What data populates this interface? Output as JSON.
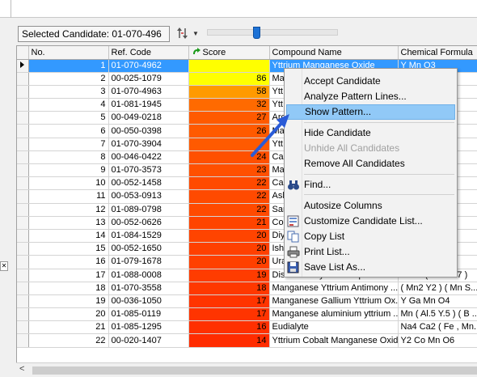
{
  "toolbar": {
    "selected_candidate": "Selected Candidate: 01-070-496"
  },
  "grid": {
    "columns": [
      "No.",
      "Ref. Code",
      "Score",
      "Compound Name",
      "Chemical Formula"
    ],
    "rows": [
      {
        "no": "1",
        "ref": "01-070-4962",
        "score": "",
        "name": "Yttrium Manganese Oxide",
        "formula": "Y Mn O3",
        "color": "#ffff00"
      },
      {
        "no": "2",
        "ref": "00-025-1079",
        "score": "86",
        "name": "Ma",
        "formula": "",
        "color": "#ffff00"
      },
      {
        "no": "3",
        "ref": "01-070-4963",
        "score": "58",
        "name": "Ytt",
        "formula": "",
        "color": "#ff9a00"
      },
      {
        "no": "4",
        "ref": "01-081-1945",
        "score": "32",
        "name": "Ytt",
        "formula": "",
        "color": "#ff6a00"
      },
      {
        "no": "5",
        "ref": "00-049-0218",
        "score": "27",
        "name": "Arc",
        "formula": "O7",
        "color": "#ff5a00"
      },
      {
        "no": "6",
        "ref": "00-050-0398",
        "score": "26",
        "name": "Ma",
        "formula": "",
        "color": "#ff5a00"
      },
      {
        "no": "7",
        "ref": "01-070-3904",
        "score": "",
        "name": "Ytt",
        "formula": "O6 ..",
        "color": "#ff5a00"
      },
      {
        "no": "8",
        "ref": "00-046-0422",
        "score": "24",
        "name": "Cal",
        "formula": "",
        "color": "#ff5000"
      },
      {
        "no": "9",
        "ref": "01-070-3573",
        "score": "23",
        "name": "Ma",
        "formula": "3 ) (",
        "color": "#ff5000"
      },
      {
        "no": "10",
        "ref": "00-052-1458",
        "score": "22",
        "name": "Cal",
        "formula": "7",
        "color": "#ff4a00"
      },
      {
        "no": "11",
        "ref": "00-053-0913",
        "score": "22",
        "name": "Ash",
        "formula": "",
        "color": "#ff4a00"
      },
      {
        "no": "12",
        "ref": "01-089-0798",
        "score": "22",
        "name": "Sar",
        "formula": "5 C",
        "color": "#ff4a00"
      },
      {
        "no": "13",
        "ref": "00-052-0626",
        "score": "21",
        "name": "Cop",
        "formula": "( Y",
        "color": "#ff4400"
      },
      {
        "no": "14",
        "ref": "01-084-1529",
        "score": "20",
        "name": "Diy",
        "formula": "",
        "color": "#ff4400"
      },
      {
        "no": "15",
        "ref": "00-052-1650",
        "score": "20",
        "name": "Ish",
        "formula": "( Y",
        "color": "#ff4000"
      },
      {
        "no": "16",
        "ref": "01-079-1678",
        "score": "20",
        "name": "Ura",
        "formula": "",
        "color": "#ff4000"
      },
      {
        "no": "17",
        "ref": "01-088-0008",
        "score": "19",
        "name": "Distrontium yttrium heptaoxodi...",
        "formula": "Sr2 Y ( Mn2 O7 )",
        "color": "#ff3c00"
      },
      {
        "no": "18",
        "ref": "01-070-3558",
        "score": "18",
        "name": "Manganese Yttrium Antimony ...",
        "formula": "( Mn2 Y2 ) ( Mn S...",
        "color": "#ff3800"
      },
      {
        "no": "19",
        "ref": "00-036-1050",
        "score": "17",
        "name": "Manganese Gallium Yttrium Ox...",
        "formula": "Y Ga Mn O4",
        "color": "#ff3400"
      },
      {
        "no": "20",
        "ref": "01-085-0119",
        "score": "17",
        "name": "Manganese aluminium yttrium ...",
        "formula": "Mn ( Al.5 Y.5 ) ( B ...",
        "color": "#ff3400"
      },
      {
        "no": "21",
        "ref": "01-085-1295",
        "score": "16",
        "name": "Eudialyte",
        "formula": "Na4 Ca2 ( Fe , Mn...",
        "color": "#ff3000"
      },
      {
        "no": "22",
        "ref": "00-020-1407",
        "score": "14",
        "name": "Yttrium Cobalt Manganese Oxide",
        "formula": "Y2 Co Mn O6",
        "color": "#ff2c00"
      }
    ]
  },
  "context_menu": {
    "items": [
      {
        "label": "Accept Candidate",
        "state": "normal",
        "icon": ""
      },
      {
        "label": "Analyze Pattern Lines...",
        "state": "normal",
        "icon": ""
      },
      {
        "label": "Show Pattern...",
        "state": "highlighted",
        "icon": ""
      },
      {
        "label": "Hide Candidate",
        "state": "normal",
        "icon": ""
      },
      {
        "label": "Unhide All Candidates",
        "state": "disabled",
        "icon": ""
      },
      {
        "label": "Remove All Candidates",
        "state": "normal",
        "icon": ""
      },
      {
        "label": "Find...",
        "state": "normal",
        "icon": "binoculars-icon"
      },
      {
        "label": "Autosize Columns",
        "state": "normal",
        "icon": ""
      },
      {
        "label": "Customize Candidate List...",
        "state": "normal",
        "icon": "customize-icon"
      },
      {
        "label": "Copy List",
        "state": "normal",
        "icon": "copy-icon"
      },
      {
        "label": "Print List...",
        "state": "normal",
        "icon": "print-icon"
      },
      {
        "label": "Save List As...",
        "state": "normal",
        "icon": "save-icon"
      }
    ]
  },
  "colors": {
    "selection": "#3399ff",
    "menu_highlight": "#91c9f7",
    "annotation_arrow": "#2a5bd7"
  }
}
